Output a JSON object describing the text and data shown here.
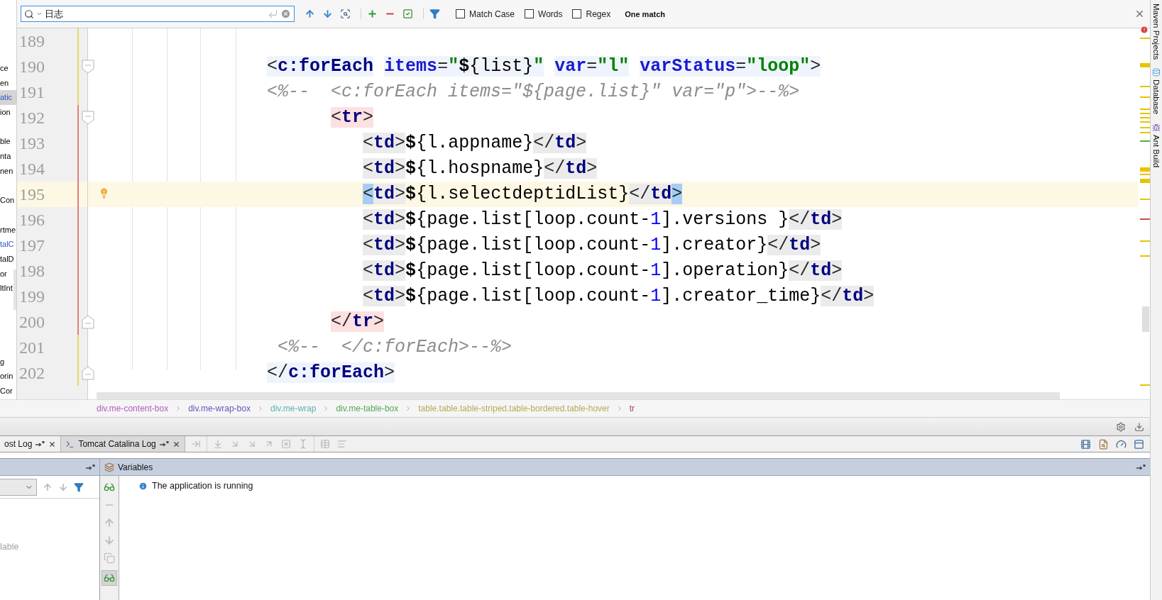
{
  "search": {
    "query": "日志",
    "options": [
      {
        "label": "Match Case",
        "checked": false
      },
      {
        "label": "Words",
        "checked": false
      },
      {
        "label": "Regex",
        "checked": false
      }
    ],
    "result": "One match"
  },
  "project_panel": {
    "items": [
      {
        "kind": "text",
        "text": "ce",
        "selected": false
      },
      {
        "kind": "text",
        "text": "en",
        "selected": false
      },
      {
        "kind": "text",
        "text": "atic",
        "color": "#2f55c8",
        "selected": true
      },
      {
        "kind": "text",
        "text": "ion",
        "selected": false
      },
      {
        "kind": "blank"
      },
      {
        "kind": "text",
        "text": "ble",
        "selected": false
      },
      {
        "kind": "text",
        "text": "nta",
        "selected": false
      },
      {
        "kind": "text",
        "text": "nen",
        "selected": false
      },
      {
        "kind": "blank"
      },
      {
        "kind": "text",
        "text": "Con",
        "selected": false
      },
      {
        "kind": "blank"
      },
      {
        "kind": "text",
        "text": "rtme",
        "selected": false
      },
      {
        "kind": "text",
        "text": "talC",
        "color": "#2f55c8",
        "selected": false
      },
      {
        "kind": "text",
        "text": "talD",
        "selected": false
      },
      {
        "kind": "text",
        "text": "or",
        "selected": false
      },
      {
        "kind": "text",
        "text": "ltInt",
        "selected": false
      },
      {
        "kind": "blank"
      },
      {
        "kind": "blank"
      },
      {
        "kind": "blank"
      },
      {
        "kind": "blank"
      },
      {
        "kind": "text",
        "text": "g",
        "selected": false
      },
      {
        "kind": "text",
        "text": "orin",
        "selected": false
      },
      {
        "kind": "text",
        "text": "Cor",
        "selected": false
      }
    ]
  },
  "editor": {
    "lines": [
      {
        "number": "189",
        "color": "#e3d870",
        "current": false,
        "intention": false,
        "fold_start": false,
        "fold_end": false
      },
      {
        "number": "190",
        "color": "#e3d870",
        "current": false,
        "intention": false,
        "fold_start": true,
        "fold_end": false,
        "segments": [
          {
            "text": "                <",
            "kind": "punct_scope"
          },
          {
            "text": "c:forEach",
            "kind": "tag_scope"
          },
          {
            "text": " items",
            "kind": "attr_scope"
          },
          {
            "text": "=",
            "kind": "punct_scope"
          },
          {
            "text": "\"",
            "kind": "string_scope"
          },
          {
            "text": "$",
            "kind": "dollar_scope"
          },
          {
            "text": "{list}",
            "kind": "text_scope"
          },
          {
            "text": "\"",
            "kind": "string_scope"
          },
          {
            "text": " var",
            "kind": "attr_scope"
          },
          {
            "text": "=",
            "kind": "punct_scope"
          },
          {
            "text": "\"l\"",
            "kind": "string_scope"
          },
          {
            "text": " varStatus",
            "kind": "attr_scope"
          },
          {
            "text": "=",
            "kind": "punct_scope"
          },
          {
            "text": "\"loop\"",
            "kind": "string_scope"
          },
          {
            "text": ">",
            "kind": "punct_scope"
          }
        ]
      },
      {
        "number": "191",
        "color": "#e3d870",
        "current": false,
        "intention": false,
        "fold_start": false,
        "fold_end": false,
        "segments": [
          {
            "text": "                <%--  <c:forEach items=\"${page.list}\" var=\"p\">--%>",
            "kind": "comment"
          }
        ]
      },
      {
        "number": "192",
        "color": "#e57c7c",
        "current": false,
        "intention": false,
        "fold_start": true,
        "fold_end": false,
        "segments": [
          {
            "text": "                      <",
            "kind": "punct_pair"
          },
          {
            "text": "tr",
            "kind": "tag_pair"
          },
          {
            "text": ">",
            "kind": "punct_pair"
          }
        ]
      },
      {
        "number": "193",
        "color": "#e57c7c",
        "current": false,
        "intention": false,
        "fold_start": false,
        "fold_end": false,
        "segments": [
          {
            "text": "                         <",
            "kind": "punct_box"
          },
          {
            "text": "td",
            "kind": "tag_box"
          },
          {
            "text": ">",
            "kind": "punct_box"
          },
          {
            "text": "$",
            "kind": "dollar"
          },
          {
            "text": "{l.appname}",
            "kind": "text"
          },
          {
            "text": "</",
            "kind": "punct_box"
          },
          {
            "text": "td",
            "kind": "tag_box"
          },
          {
            "text": ">",
            "kind": "punct_box"
          }
        ]
      },
      {
        "number": "194",
        "color": "#e57c7c",
        "current": false,
        "intention": false,
        "fold_start": false,
        "fold_end": false,
        "segments": [
          {
            "text": "                         <",
            "kind": "punct_box"
          },
          {
            "text": "td",
            "kind": "tag_box"
          },
          {
            "text": ">",
            "kind": "punct_box"
          },
          {
            "text": "$",
            "kind": "dollar"
          },
          {
            "text": "{l.hospname}",
            "kind": "text"
          },
          {
            "text": "</",
            "kind": "punct_box"
          },
          {
            "text": "td",
            "kind": "tag_box"
          },
          {
            "text": ">",
            "kind": "punct_box"
          }
        ]
      },
      {
        "number": "195",
        "color": "#e57c7c",
        "current": true,
        "intention": true,
        "fold_start": false,
        "fold_end": false,
        "segments": [
          {
            "text": "                         <",
            "kind": "punct_match"
          },
          {
            "text": "td",
            "kind": "tag_box"
          },
          {
            "text": ">",
            "kind": "punct_box"
          },
          {
            "text": "$",
            "kind": "dollar"
          },
          {
            "text": "{l.selectdeptidList}",
            "kind": "text"
          },
          {
            "text": "</",
            "kind": "punct_box"
          },
          {
            "text": "td",
            "kind": "tag_box"
          },
          {
            "text": ">",
            "kind": "punct_match"
          }
        ]
      },
      {
        "number": "196",
        "color": "#e57c7c",
        "current": false,
        "intention": false,
        "fold_start": false,
        "fold_end": false,
        "segments": [
          {
            "text": "                         <",
            "kind": "punct_box"
          },
          {
            "text": "td",
            "kind": "tag_box"
          },
          {
            "text": ">",
            "kind": "punct_box"
          },
          {
            "text": "$",
            "kind": "dollar"
          },
          {
            "text": "{page.list[loop.count-",
            "kind": "text"
          },
          {
            "text": "1",
            "kind": "number"
          },
          {
            "text": "].versions }",
            "kind": "text"
          },
          {
            "text": "</",
            "kind": "punct_box"
          },
          {
            "text": "td",
            "kind": "tag_box"
          },
          {
            "text": ">",
            "kind": "punct_box"
          }
        ]
      },
      {
        "number": "197",
        "color": "#e57c7c",
        "current": false,
        "intention": false,
        "fold_start": false,
        "fold_end": false,
        "segments": [
          {
            "text": "                         <",
            "kind": "punct_box"
          },
          {
            "text": "td",
            "kind": "tag_box"
          },
          {
            "text": ">",
            "kind": "punct_box"
          },
          {
            "text": "$",
            "kind": "dollar"
          },
          {
            "text": "{page.list[loop.count-",
            "kind": "text"
          },
          {
            "text": "1",
            "kind": "number"
          },
          {
            "text": "].creator}",
            "kind": "text"
          },
          {
            "text": "</",
            "kind": "punct_box"
          },
          {
            "text": "td",
            "kind": "tag_box"
          },
          {
            "text": ">",
            "kind": "punct_box"
          }
        ]
      },
      {
        "number": "198",
        "color": "#e57c7c",
        "current": false,
        "intention": false,
        "fold_start": false,
        "fold_end": false,
        "segments": [
          {
            "text": "                         <",
            "kind": "punct_box"
          },
          {
            "text": "td",
            "kind": "tag_box"
          },
          {
            "text": ">",
            "kind": "punct_box"
          },
          {
            "text": "$",
            "kind": "dollar"
          },
          {
            "text": "{page.list[loop.count-",
            "kind": "text"
          },
          {
            "text": "1",
            "kind": "number"
          },
          {
            "text": "].operation}",
            "kind": "text"
          },
          {
            "text": "</",
            "kind": "punct_box"
          },
          {
            "text": "td",
            "kind": "tag_box"
          },
          {
            "text": ">",
            "kind": "punct_box"
          }
        ]
      },
      {
        "number": "199",
        "color": "#e57c7c",
        "current": false,
        "intention": false,
        "fold_start": false,
        "fold_end": false,
        "segments": [
          {
            "text": "                         <",
            "kind": "punct_box"
          },
          {
            "text": "td",
            "kind": "tag_box"
          },
          {
            "text": ">",
            "kind": "punct_box"
          },
          {
            "text": "$",
            "kind": "dollar"
          },
          {
            "text": "{page.list[loop.count-",
            "kind": "text"
          },
          {
            "text": "1",
            "kind": "number"
          },
          {
            "text": "].creator_time}",
            "kind": "text"
          },
          {
            "text": "</",
            "kind": "punct_box"
          },
          {
            "text": "td",
            "kind": "tag_box"
          },
          {
            "text": ">",
            "kind": "punct_box"
          }
        ]
      },
      {
        "number": "200",
        "color": "#e57c7c",
        "current": false,
        "intention": false,
        "fold_start": false,
        "fold_end": true,
        "segments": [
          {
            "text": "                      </",
            "kind": "punct_pair"
          },
          {
            "text": "tr",
            "kind": "tag_pair"
          },
          {
            "text": ">",
            "kind": "punct_pair"
          }
        ]
      },
      {
        "number": "201",
        "color": "#e3d870",
        "current": false,
        "intention": false,
        "fold_start": false,
        "fold_end": false,
        "segments": [
          {
            "text": "                 <%--  </c:forEach>--%>",
            "kind": "comment"
          }
        ]
      },
      {
        "number": "202",
        "color": "#e3d870",
        "current": false,
        "intention": false,
        "fold_start": false,
        "fold_end": true,
        "segments": [
          {
            "text": "                </",
            "kind": "punct_scope"
          },
          {
            "text": "c:forEach",
            "kind": "tag_scope"
          },
          {
            "text": ">",
            "kind": "punct_scope"
          }
        ]
      }
    ]
  },
  "breadcrumbs": [
    {
      "label": "div.me-content-box",
      "color": "#b45cc0"
    },
    {
      "label": "div.me-wrap-box",
      "color": "#6658b8"
    },
    {
      "label": "div.me-wrap",
      "color": "#5cb2b5"
    },
    {
      "label": "div.me-table-box",
      "color": "#55a85a"
    },
    {
      "label": "table.table.table-striped.table-bordered.table-hover",
      "color": "#b0ad55"
    },
    {
      "label": "tr",
      "color": "#a04848"
    }
  ],
  "tool_window": {
    "tabs": [
      {
        "label": "ost Log",
        "selected": false
      },
      {
        "label": "Tomcat Catalina Log",
        "selected": true
      }
    ],
    "frames": {
      "empty_text": "lable"
    },
    "variables": {
      "title": "Variables",
      "message": "The application is running"
    }
  },
  "side_tools": [
    {
      "label": "Maven Projects"
    },
    {
      "label": "Database"
    },
    {
      "label": "Ant Build"
    }
  ]
}
